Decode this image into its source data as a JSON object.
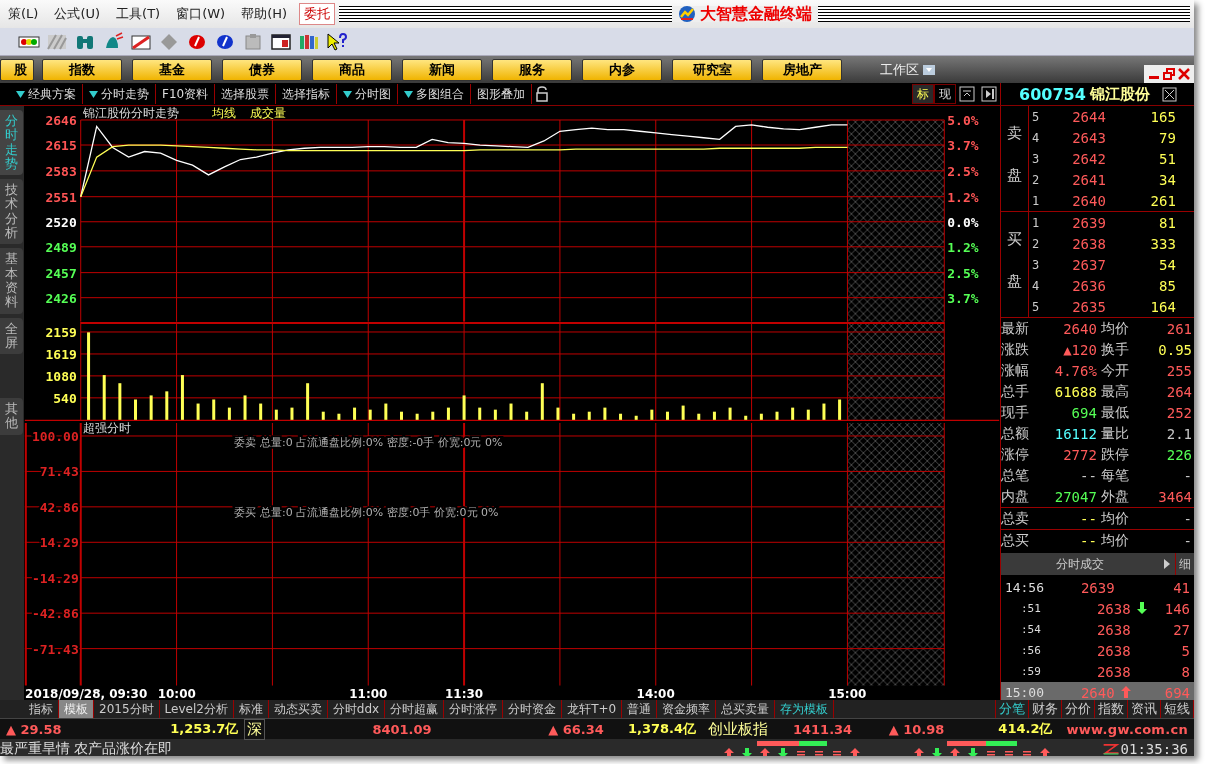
{
  "menu": {
    "items": [
      "策(L)",
      "公式(U)",
      "工具(T)",
      "窗口(W)",
      "帮助(H)"
    ],
    "trade_button": "委托",
    "app_title": "大智慧金融终端"
  },
  "toolbar": {
    "icons": [
      {
        "kind": "traffic"
      },
      {
        "kind": "hatch"
      },
      {
        "kind": "binoculars"
      },
      {
        "kind": "bell"
      },
      {
        "kind": "flag"
      },
      {
        "kind": "diamond"
      },
      {
        "kind": "red-coin"
      },
      {
        "kind": "blue-coin"
      },
      {
        "kind": "clipboard"
      },
      {
        "kind": "window"
      },
      {
        "kind": "books"
      },
      {
        "kind": "help"
      }
    ]
  },
  "nav_buttons": [
    "股",
    "指数",
    "基金",
    "债券",
    "商品",
    "新闻",
    "服务",
    "内参",
    "研究室",
    "房地产"
  ],
  "workspace": {
    "label": "工作区"
  },
  "sub_toolbar": [
    {
      "label": "经典方案",
      "dropdown": true
    },
    {
      "label": "分时走势",
      "dropdown": true
    },
    {
      "label": "F10资料",
      "dropdown": false
    },
    {
      "label": "选择股票",
      "dropdown": false
    },
    {
      "label": "选择指标",
      "dropdown": false
    },
    {
      "label": "分时图",
      "dropdown": true
    },
    {
      "label": "多图组合",
      "dropdown": true
    },
    {
      "label": "图形叠加",
      "dropdown": false
    }
  ],
  "view_toggles": [
    {
      "label": "标",
      "selected": true
    },
    {
      "label": "现",
      "selected": false
    }
  ],
  "side_tabs": [
    {
      "label": "分时走势",
      "selected": true
    },
    {
      "label": "技术分析",
      "selected": false
    },
    {
      "label": "基本资料",
      "selected": false
    },
    {
      "label": "全屏",
      "selected": false
    },
    {
      "label": "其他",
      "selected": false
    }
  ],
  "price_chart": {
    "right_axis": [
      {
        "label": "5.0%",
        "color": "#ff5555"
      },
      {
        "label": "3.7%",
        "color": "#ff5555"
      },
      {
        "label": "2.5%",
        "color": "#ff5555"
      },
      {
        "label": "1.2%",
        "color": "#ff5555"
      },
      {
        "label": "0.0%",
        "color": "#ffffff"
      },
      {
        "label": "1.2%",
        "color": "#55ff55"
      },
      {
        "label": "2.5%",
        "color": "#55ff55"
      },
      {
        "label": "3.7%",
        "color": "#55ff55"
      }
    ],
    "chart_data": {
      "type": "line",
      "title": "锦江股份分时走势",
      "ylim": [
        2426,
        2646
      ],
      "grid": true,
      "yticks": [
        {
          "value": 2646,
          "label": "2646"
        },
        {
          "value": 2615,
          "label": "2615"
        },
        {
          "value": 2583,
          "label": "2583"
        },
        {
          "value": 2551,
          "label": "2551"
        },
        {
          "value": 2520,
          "label": "2520"
        },
        {
          "value": 2489,
          "label": "2489"
        },
        {
          "value": 2457,
          "label": "2457"
        },
        {
          "value": 2426,
          "label": "2426"
        }
      ],
      "series": [
        {
          "color": "#ffffff",
          "values": [
            2551,
            2638,
            2612,
            2600,
            2607,
            2605,
            2596,
            2590,
            2578,
            2588,
            2597,
            2600,
            2605,
            2609,
            2611,
            2612,
            2612,
            2612,
            2613,
            2613,
            2612,
            2612,
            2622,
            2618,
            2617,
            2615,
            2614,
            2613,
            2612,
            2620,
            2632,
            2634,
            2636,
            2634,
            2634,
            2632,
            2630,
            2628,
            2626,
            2624,
            2622,
            2638,
            2640,
            2637,
            2635,
            2634,
            2637,
            2640,
            2640
          ]
        },
        {
          "name": "均线",
          "color": "#ffff55",
          "values": [
            2551,
            2600,
            2613,
            2615,
            2615,
            2615,
            2614,
            2613,
            2612,
            2611,
            2610,
            2609,
            2609,
            2608,
            2608,
            2608,
            2608,
            2608,
            2608,
            2608,
            2608,
            2608,
            2608,
            2608,
            2608,
            2609,
            2609,
            2609,
            2609,
            2609,
            2609,
            2610,
            2610,
            2610,
            2610,
            2610,
            2610,
            2610,
            2610,
            2610,
            2611,
            2611,
            2611,
            2611,
            2611,
            2611,
            2612,
            2612,
            2612
          ]
        }
      ]
    }
  },
  "time_axis": [
    "2018/09/28, 09:30",
    "10:00",
    "11:00",
    "11:30",
    "14:00",
    "15:00"
  ],
  "volume_chart": {
    "chart_data": {
      "type": "bar",
      "title": "成交量",
      "ylim": [
        0,
        2159
      ],
      "grid": true,
      "yticks": [
        {
          "value": 2159,
          "label": "2159"
        },
        {
          "value": 1619,
          "label": "1619"
        },
        {
          "value": 1080,
          "label": "1080"
        },
        {
          "value": 540,
          "label": "540"
        }
      ],
      "values": [
        2150,
        1100,
        900,
        500,
        600,
        700,
        1100,
        400,
        500,
        300,
        600,
        400,
        250,
        300,
        900,
        200,
        150,
        300,
        250,
        400,
        200,
        150,
        200,
        300,
        600,
        300,
        250,
        400,
        200,
        900,
        300,
        150,
        200,
        300,
        150,
        100,
        250,
        200,
        350,
        150,
        200,
        300,
        100,
        150,
        200,
        300,
        250,
        400,
        500
      ]
    }
  },
  "indicator": {
    "title": "超强分时",
    "y_labels": [
      "100.00",
      "71.43",
      "42.86",
      "14.29",
      "-14.29",
      "-42.86",
      "-71.43"
    ],
    "lines": [
      "委卖 总量:0 占流通盘比例:0% 密度:-0手 价宽:0元 0%",
      "委买 总量:0 占流通盘比例:0% 密度:0手 价宽:0元 0%"
    ]
  },
  "quote": {
    "code": "600754",
    "name": "锦江股份"
  },
  "order_book": {
    "sell_label": "卖盘",
    "buy_label": "买盘",
    "sell": [
      {
        "rank": "5",
        "price": "2644",
        "volume": "165"
      },
      {
        "rank": "4",
        "price": "2643",
        "volume": "79"
      },
      {
        "rank": "3",
        "price": "2642",
        "volume": "51"
      },
      {
        "rank": "2",
        "price": "2641",
        "volume": "34"
      },
      {
        "rank": "1",
        "price": "2640",
        "volume": "261"
      }
    ],
    "buy": [
      {
        "rank": "1",
        "price": "2639",
        "volume": "81"
      },
      {
        "rank": "2",
        "price": "2638",
        "volume": "333"
      },
      {
        "rank": "3",
        "price": "2637",
        "volume": "54"
      },
      {
        "rank": "4",
        "price": "2636",
        "volume": "85"
      },
      {
        "rank": "5",
        "price": "2635",
        "volume": "164"
      }
    ]
  },
  "stats": [
    {
      "divider": false,
      "cells": [
        {
          "label": "最新",
          "value": "2640",
          "color": "#ff5a5a"
        },
        {
          "label": "均价",
          "value": "261",
          "color": "#ff5a5a"
        }
      ]
    },
    {
      "divider": false,
      "cells": [
        {
          "label": "涨跌",
          "value": "▲120",
          "color": "#ff5a5a"
        },
        {
          "label": "换手",
          "value": "0.95",
          "color": "#ffff55"
        }
      ]
    },
    {
      "divider": false,
      "cells": [
        {
          "label": "涨幅",
          "value": "4.76%",
          "color": "#ff5a5a"
        },
        {
          "label": "今开",
          "value": "255",
          "color": "#ff5a5a"
        }
      ]
    },
    {
      "divider": false,
      "cells": [
        {
          "label": "总手",
          "value": "61688",
          "color": "#ffff55"
        },
        {
          "label": "最高",
          "value": "264",
          "color": "#ff5a5a"
        }
      ]
    },
    {
      "divider": false,
      "cells": [
        {
          "label": "现手",
          "value": "694",
          "color": "#55ff55"
        },
        {
          "label": "最低",
          "value": "252",
          "color": "#ff5a5a"
        }
      ]
    },
    {
      "divider": false,
      "cells": [
        {
          "label": "总额",
          "value": "16112",
          "color": "#55ffff"
        },
        {
          "label": "量比",
          "value": "2.1",
          "color": "#c8c8c8"
        }
      ]
    },
    {
      "divider": false,
      "cells": [
        {
          "label": "涨停",
          "value": "2772",
          "color": "#ff5a5a"
        },
        {
          "label": "跌停",
          "value": "226",
          "color": "#55ff55"
        }
      ]
    },
    {
      "divider": false,
      "cells": [
        {
          "label": "总笔",
          "value": "--",
          "color": "#c8c8c8"
        },
        {
          "label": "每笔",
          "value": "-",
          "color": "#c8c8c8"
        }
      ]
    },
    {
      "divider": false,
      "cells": [
        {
          "label": "内盘",
          "value": "27047",
          "color": "#55ff55"
        },
        {
          "label": "外盘",
          "value": "3464",
          "color": "#ff5a5a"
        }
      ]
    },
    {
      "divider": true,
      "cells": [
        {
          "label": "总卖",
          "value": "--",
          "color": "#ffff55"
        },
        {
          "label": "均价",
          "value": "-",
          "color": "#c8c8c8"
        }
      ]
    },
    {
      "divider": true,
      "cells": [
        {
          "label": "总买",
          "value": "--",
          "color": "#ffff55"
        },
        {
          "label": "均价",
          "value": "-",
          "color": "#c8c8c8"
        }
      ]
    }
  ],
  "trades": {
    "title": "分时成交",
    "more": "细",
    "rows": [
      {
        "time": "14:56",
        "price": "2639",
        "volume": "41",
        "up_arrow": false,
        "down_arrow": false,
        "highlighted": false
      },
      {
        "time": ":51",
        "price": "2638",
        "volume": "146",
        "up_arrow": false,
        "down_arrow": true,
        "highlighted": false
      },
      {
        "time": ":54",
        "price": "2638",
        "volume": "27",
        "up_arrow": false,
        "down_arrow": false,
        "highlighted": false
      },
      {
        "time": ":56",
        "price": "2638",
        "volume": "5",
        "up_arrow": false,
        "down_arrow": false,
        "highlighted": false
      },
      {
        "time": ":59",
        "price": "2638",
        "volume": "8",
        "up_arrow": false,
        "down_arrow": false,
        "highlighted": false
      },
      {
        "time": "15:00",
        "price": "2640",
        "volume": "694",
        "up_arrow": true,
        "down_arrow": false,
        "highlighted": true
      }
    ]
  },
  "bottom_tabs": [
    {
      "label": "指标",
      "kind": "tab",
      "selected": false
    },
    {
      "label": "模板",
      "kind": "tab",
      "selected": true
    },
    {
      "label": "2015分时",
      "kind": "tab",
      "selected": false
    },
    {
      "label": "Level2分析",
      "kind": "tab",
      "selected": false
    },
    {
      "label": "标准",
      "kind": "tab",
      "selected": false
    },
    {
      "label": "动态买卖",
      "kind": "tab",
      "selected": false
    },
    {
      "label": "分时ddx",
      "kind": "tab",
      "selected": false
    },
    {
      "label": "分时超赢",
      "kind": "tab",
      "selected": false
    },
    {
      "label": "分时涨停",
      "kind": "tab",
      "selected": false
    },
    {
      "label": "分时资金",
      "kind": "tab",
      "selected": false
    },
    {
      "label": "龙轩T+0",
      "kind": "tab",
      "selected": false
    },
    {
      "label": "普通",
      "kind": "tab",
      "selected": false
    },
    {
      "label": "资金频率",
      "kind": "tab",
      "selected": false
    },
    {
      "label": "总买卖量",
      "kind": "tab",
      "selected": false
    },
    {
      "label": "存为模板",
      "kind": "action",
      "selected": false
    }
  ],
  "right_tabs": [
    {
      "label": "分笔",
      "selected": true
    },
    {
      "label": "财务",
      "selected": false
    },
    {
      "label": "分价",
      "selected": false
    },
    {
      "label": "指数",
      "selected": false
    },
    {
      "label": "资讯",
      "selected": false
    },
    {
      "label": "短线",
      "selected": false
    }
  ],
  "status_bar": [
    {
      "text": "▲ 29.58",
      "kind": "value",
      "color": "#ff5a5a"
    },
    {
      "text": "1,253.7亿",
      "kind": "value",
      "color": "#ffff55"
    },
    {
      "text": "深",
      "kind": "label",
      "color": "#ffff99"
    },
    {
      "text": "8401.09",
      "kind": "value",
      "color": "#ff5a5a"
    },
    {
      "text": "▲ 66.34",
      "kind": "value",
      "color": "#ff5a5a"
    },
    {
      "text": "1,378.4亿",
      "kind": "value",
      "color": "#ffff55"
    },
    {
      "text": "创业板指",
      "kind": "label",
      "color": "#ffff99"
    },
    {
      "text": "1411.34",
      "kind": "value",
      "color": "#ff5a5a"
    },
    {
      "text": "▲ 10.98",
      "kind": "value",
      "color": "#ff5a5a"
    },
    {
      "text": "414.2亿",
      "kind": "value",
      "color": "#ffff55"
    },
    {
      "text": "www.gw.com.cn",
      "kind": "link",
      "color": "#ff5a5a"
    }
  ],
  "ticker": "最严重旱情 农产品涨价在即",
  "market_signals": [
    {
      "level": 0.6,
      "arrows": [
        {
          "kind": "up"
        },
        {
          "kind": "down"
        },
        {
          "kind": "up"
        },
        {
          "kind": "down"
        },
        {
          "kind": "eq"
        },
        {
          "kind": "eq"
        },
        {
          "kind": "eq"
        },
        {
          "kind": "up"
        }
      ]
    },
    {
      "level": 0.55,
      "arrows": [
        {
          "kind": "up"
        },
        {
          "kind": "down"
        },
        {
          "kind": "up"
        },
        {
          "kind": "down"
        },
        {
          "kind": "eq"
        },
        {
          "kind": "eq"
        },
        {
          "kind": "eq"
        },
        {
          "kind": "up"
        }
      ]
    }
  ],
  "clock": "01:35:36"
}
